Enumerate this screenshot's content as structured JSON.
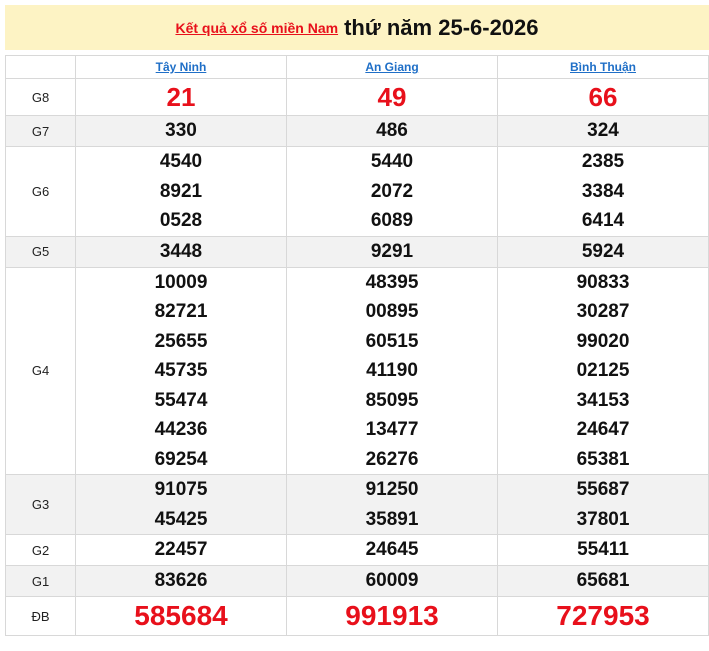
{
  "header": {
    "link_text": "Kết quả xổ số miền Nam",
    "date_text": "thứ năm 25-6-2026"
  },
  "columns": [
    "Tây Ninh",
    "An Giang",
    "Bình Thuận"
  ],
  "rows": [
    {
      "label": "G8",
      "values": [
        [
          "21"
        ],
        [
          "49"
        ],
        [
          "66"
        ]
      ]
    },
    {
      "label": "G7",
      "values": [
        [
          "330"
        ],
        [
          "486"
        ],
        [
          "324"
        ]
      ]
    },
    {
      "label": "G6",
      "values": [
        [
          "4540",
          "8921",
          "0528"
        ],
        [
          "5440",
          "2072",
          "6089"
        ],
        [
          "2385",
          "3384",
          "6414"
        ]
      ]
    },
    {
      "label": "G5",
      "values": [
        [
          "3448"
        ],
        [
          "9291"
        ],
        [
          "5924"
        ]
      ]
    },
    {
      "label": "G4",
      "values": [
        [
          "10009",
          "82721",
          "25655",
          "45735",
          "55474",
          "44236",
          "69254"
        ],
        [
          "48395",
          "00895",
          "60515",
          "41190",
          "85095",
          "13477",
          "26276"
        ],
        [
          "90833",
          "30287",
          "99020",
          "02125",
          "34153",
          "24647",
          "65381"
        ]
      ]
    },
    {
      "label": "G3",
      "values": [
        [
          "91075",
          "45425"
        ],
        [
          "91250",
          "35891"
        ],
        [
          "55687",
          "37801"
        ]
      ]
    },
    {
      "label": "G2",
      "values": [
        [
          "22457"
        ],
        [
          "24645"
        ],
        [
          "55411"
        ]
      ]
    },
    {
      "label": "G1",
      "values": [
        [
          "83626"
        ],
        [
          "60009"
        ],
        [
          "65681"
        ]
      ]
    },
    {
      "label": "ĐB",
      "values": [
        [
          "585684"
        ],
        [
          "991913"
        ],
        [
          "727953"
        ]
      ]
    }
  ],
  "colors": {
    "accent_red": "#e8101b",
    "link_blue": "#1f6fc7",
    "header_bg": "#fdf3c4"
  }
}
